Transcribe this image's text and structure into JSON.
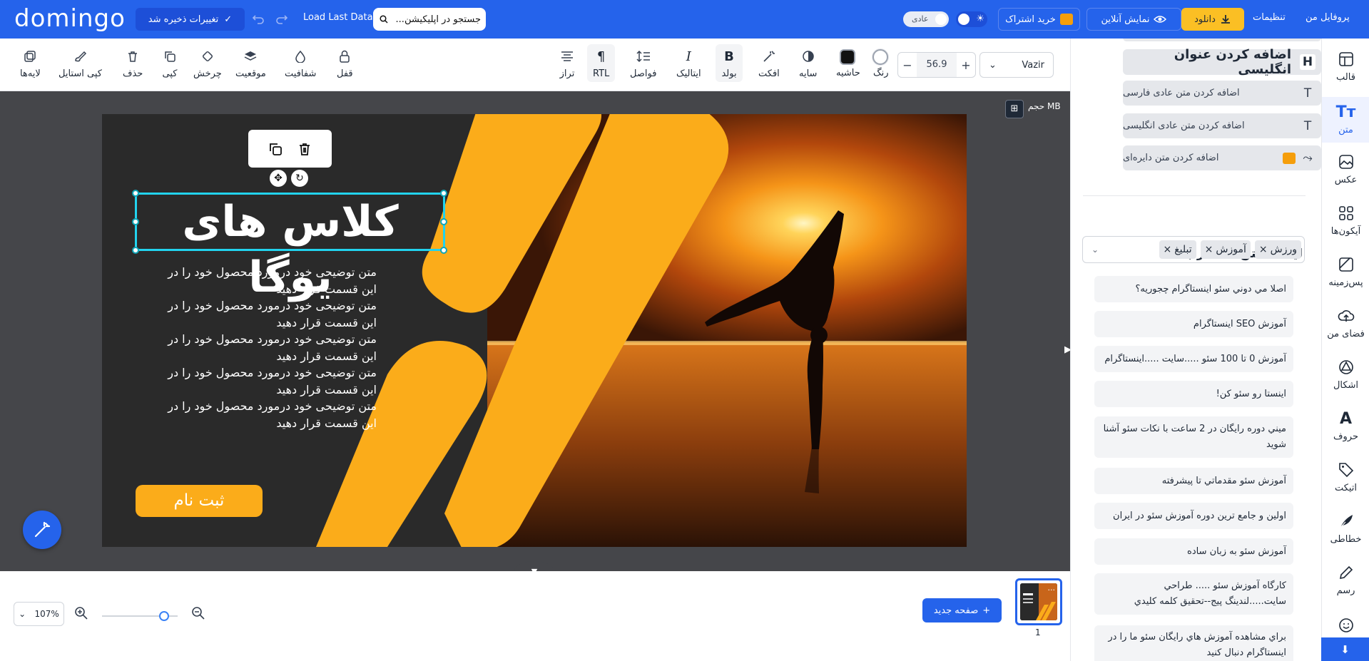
{
  "header": {
    "logo": "domingo",
    "save_label": "تغییرات ذخیره شد",
    "load_last": "Load Last Data",
    "search_placeholder": "جستجو در اپلیکیشن...",
    "mode_label": "عادی",
    "subscribe_label": "خرید اشتراک",
    "online_label": "نمایش آنلاین",
    "download_label": "دانلود",
    "settings_label": "تنظیمات",
    "profile_label": "پروفایل من"
  },
  "toolbar": {
    "font": "Vazir",
    "font_size": "56.9",
    "color_label": "رنگ",
    "border_label": "حاشیه",
    "shadow_label": "سایه",
    "effect_label": "افکت",
    "bold_label": "بولد",
    "italic_label": "ایتالیک",
    "spacing_label": "فواصل",
    "rtl_label": "RTL",
    "align_label": "تراز",
    "lock_label": "قفل",
    "opacity_label": "شفافیت",
    "position_label": "موقعیت",
    "rotate_label": "چرخش",
    "copy_label": "کپی",
    "delete_label": "حذف",
    "copy_style_label": "کپی استایل",
    "layers_label": "لایه‌ها"
  },
  "canvas": {
    "size_label": "حجم MB",
    "headline": "کلاس های یوگا",
    "body": "متن توضیحی خود درمورد محصول خود را در\nاین قسمت قرار دهید\nمتن توضیحی خود درمورد محصول خود را در\nاین قسمت قرار دهید\nمتن توضیحی خود درمورد محصول خود را در\nاین قسمت قرار دهید\nمتن توضیحی خود درمورد محصول خود را در\nاین قسمت قرار دهید\nمتن توضیحی خود درمورد محصول خود را در\nاین قسمت قرار دهید",
    "button_label": "ثبت نام",
    "accent_color": "#fbac1a"
  },
  "footer": {
    "zoom": "107%",
    "zoom_level": 0.75,
    "new_page_label": "صفحه جدید",
    "page_number": "1",
    "thumb_menu": "..."
  },
  "panel": {
    "add_items": [
      {
        "label": "اضافه کردن عنوان انگلیسی",
        "icon": "H"
      },
      {
        "label": "اضافه کردن متن عادی فارسی",
        "icon": "T"
      },
      {
        "label": "اضافه کردن متن عادی انگلیسی",
        "icon": "T"
      },
      {
        "label": "اضافه کردن متن دایره‌ای",
        "icon": "curve"
      }
    ],
    "section_title": "لیست متن‌های مرتبط",
    "tags": [
      "ورزش",
      "آموزش",
      "تبلیغ"
    ],
    "related": [
      "اصلا مي دوني سئو اينستاگرام چجوريه؟",
      "آموزش SEO اينستاگرام",
      "آموزش 0 تا 100 سئو .....سایت .....اينستاگرام",
      "اينستا رو سئو کن!",
      "ميني دوره رايگان در 2 ساعت با نکات سئو آشنا شويد",
      "آموزش سئو مقدماتي تا پيشرفته",
      "اولين و جامع ترين دوره آموزش سئو در ايران",
      "آموزش سئو به زبان ساده",
      "کارگاه آموزش سئو ..... طراحي سايت.....لندينگ پيج--تحقيق کلمه کليدي",
      "براي مشاهده آموزش هاي رايگان سئو ما را در اينستاگرام دنبال کنيد"
    ]
  },
  "sidebar": {
    "items": [
      {
        "label": "قالب",
        "icon": "template-icon"
      },
      {
        "label": "متن",
        "icon": "text-icon"
      },
      {
        "label": "عکس",
        "icon": "image-icon"
      },
      {
        "label": "آیکون‌ها",
        "icon": "icons-icon"
      },
      {
        "label": "پس‌زمینه",
        "icon": "background-icon"
      },
      {
        "label": "فضای من",
        "icon": "cloud-upload-icon"
      },
      {
        "label": "اشکال",
        "icon": "shapes-icon"
      },
      {
        "label": "حروف",
        "icon": "letters-icon"
      },
      {
        "label": "اتیکت",
        "icon": "tag-icon"
      },
      {
        "label": "خطاطی",
        "icon": "feather-icon"
      },
      {
        "label": "رسم",
        "icon": "pencil-icon"
      }
    ]
  }
}
